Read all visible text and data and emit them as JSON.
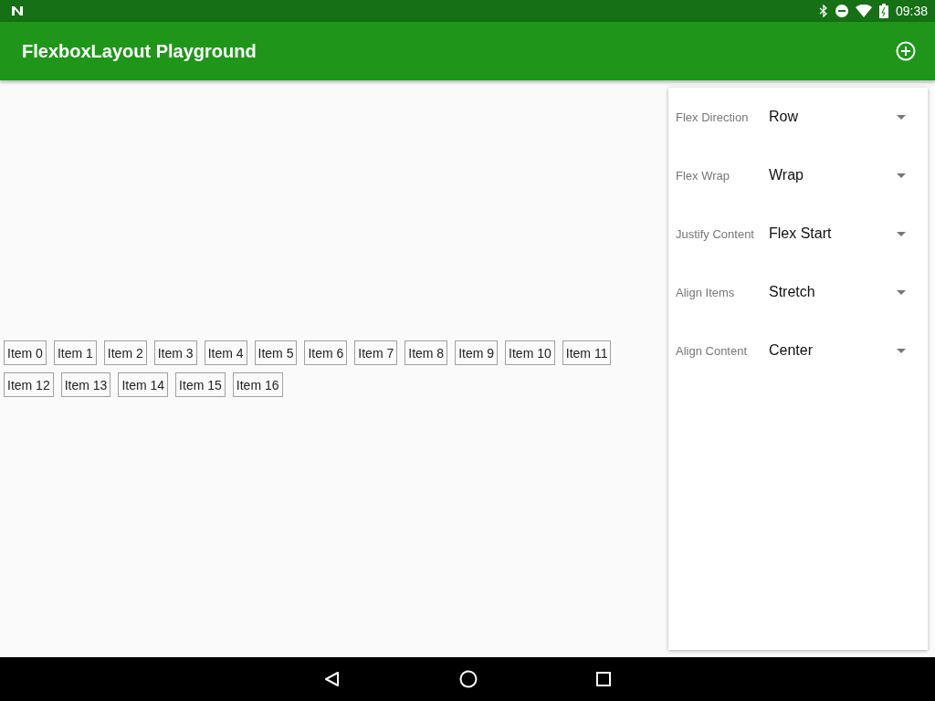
{
  "app_bar": {
    "title": "FlexboxLayout Playground"
  },
  "status_bar": {
    "time": "09:38"
  },
  "flex_items": [
    "Item 0",
    "Item 1",
    "Item 2",
    "Item 3",
    "Item 4",
    "Item 5",
    "Item 6",
    "Item 7",
    "Item 8",
    "Item 9",
    "Item 10",
    "Item 11",
    "Item 12",
    "Item 13",
    "Item 14",
    "Item 15",
    "Item 16"
  ],
  "settings": [
    {
      "label": "Flex Direction",
      "value": "Row"
    },
    {
      "label": "Flex Wrap",
      "value": "Wrap"
    },
    {
      "label": "Justify Content",
      "value": "Flex Start"
    },
    {
      "label": "Align Items",
      "value": "Stretch"
    },
    {
      "label": "Align Content",
      "value": "Center"
    }
  ]
}
